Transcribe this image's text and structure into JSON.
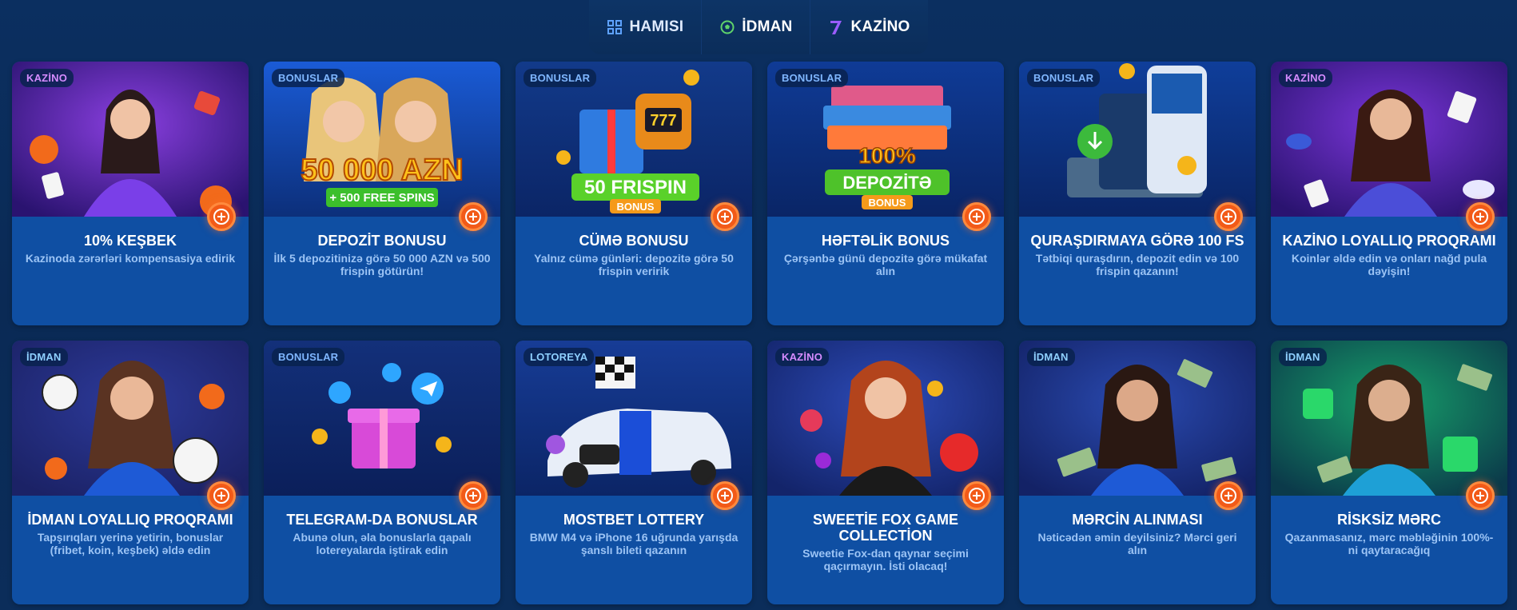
{
  "tabs": [
    {
      "label": "HAMISI",
      "icon": "grid-icon",
      "active": true
    },
    {
      "label": "İDMAN",
      "icon": "soccer-ball-icon",
      "active": false
    },
    {
      "label": "KAZİNO",
      "icon": "slot-seven-icon",
      "active": false
    }
  ],
  "colors": {
    "background": "#0a2a55",
    "card": "#0f4fa3",
    "accent": "#f25a18",
    "badge_kazino": "#d58bff",
    "badge_bonuslar": "#7fb6ff"
  },
  "promos": [
    {
      "badge": "KAZİNO",
      "title": "10% KEŞBEK",
      "desc": "Kazinoda zərərləri kompensasiya edirik"
    },
    {
      "badge": "BONUSLAR",
      "title": "DEPOZİT BONUSU",
      "desc": "İlk 5 depozitinizə görə 50 000 AZN və 500 frispin götürün!",
      "art_text": [
        "50 000 AZN",
        "+ 500 FREE SPINS"
      ]
    },
    {
      "badge": "BONUSLAR",
      "title": "CÜMƏ BONUSU",
      "desc": "Yalnız cümə günləri: depozitə görə 50 frispin veririk",
      "art_text": [
        "50 FRISPIN",
        "BONUS"
      ]
    },
    {
      "badge": "BONUSLAR",
      "title": "HƏFTƏLİK BONUS",
      "desc": "Çərşənbə günü depozitə görə mükafat alın",
      "art_text": [
        "100%",
        "DEPOZİTƏ",
        "BONUS"
      ]
    },
    {
      "badge": "BONUSLAR",
      "title": "QURAŞDIRMAYA GÖRƏ 100 FS",
      "desc": "Tətbiqi quraşdırın, depozit edin və 100 frispin qazanın!"
    },
    {
      "badge": "KAZİNO",
      "title": "KAZİNO LOYALLIQ PROQRAMI",
      "desc": "Koinlər əldə edin və onları nağd pula dəyişin!"
    },
    {
      "badge": "İDMAN",
      "title": "İDMAN LOYALLIQ PROQRAMI",
      "desc": "Tapşırıqları yerinə yetirin, bonuslar (fribet, koin, keşbek) əldə edin"
    },
    {
      "badge": "BONUSLAR",
      "title": "TELEGRAM-DA BONUSLAR",
      "desc": "Abunə olun, əla bonuslarla qapalı lotereyalarda iştirak edin"
    },
    {
      "badge": "LOTOREYA",
      "title": "MOSTBET LOTTERY",
      "desc": "BMW M4 və iPhone 16 uğrunda yarışda şanslı bileti qazanın"
    },
    {
      "badge": "KAZİNO",
      "title": "SWEETİE FOX GAME COLLECTİON",
      "desc": "Sweetie Fox-dan qaynar seçimi qaçırmayın. İsti olacaq!"
    },
    {
      "badge": "İDMAN",
      "title": "MƏRCİN ALINMASI",
      "desc": "Nəticədən əmin deyilsiniz? Mərci geri alın"
    },
    {
      "badge": "İDMAN",
      "title": "RİSKSİZ MƏRC",
      "desc": "Qazanmasanız, mərc məbləğinin 100%-ni qaytaracağıq"
    }
  ]
}
